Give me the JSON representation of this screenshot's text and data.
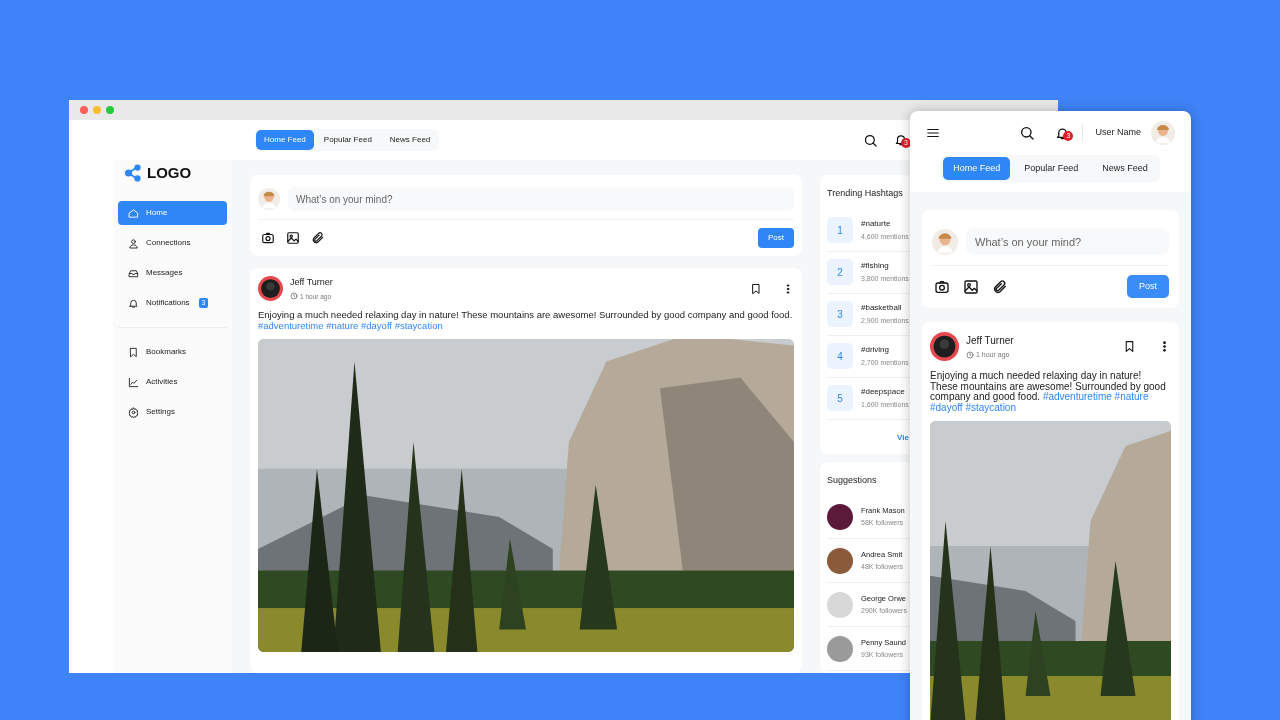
{
  "desktop": {
    "tabs": [
      {
        "label": "Home Feed",
        "selected": true
      },
      {
        "label": "Popular Feed",
        "selected": false
      },
      {
        "label": "News Feed",
        "selected": false
      }
    ],
    "notification_count": "3",
    "logo": "LOGO",
    "nav": [
      {
        "kind": "home",
        "label": "Home",
        "selected": true
      },
      {
        "kind": "user",
        "label": "Connections",
        "selected": false
      },
      {
        "kind": "inbox",
        "label": "Messages",
        "selected": false
      },
      {
        "kind": "bell",
        "label": "Notifications",
        "selected": false,
        "badge": "3"
      }
    ],
    "nav_secondary": [
      {
        "kind": "bookmark",
        "label": "Bookmarks",
        "selected": false
      },
      {
        "kind": "chart",
        "label": "Activities",
        "selected": false
      },
      {
        "kind": "gear",
        "label": "Settings",
        "selected": false
      }
    ],
    "composer": {
      "placeholder": "What’s on your mind?",
      "button": "Post"
    },
    "post": {
      "author": "Jeff Turner",
      "time": "1 hour ago",
      "text": "Enjoying a much needed relaxing day in nature! These mountains are awesome! Surrounded by good company and good food.",
      "hashtags": [
        "#adventuretime",
        "#nature",
        "#dayoff",
        "#staycation"
      ]
    },
    "trending": {
      "title": "Trending Hashtags",
      "items": [
        {
          "rank": "1",
          "tag": "#naturte",
          "mentions": "4,600 mentions"
        },
        {
          "rank": "2",
          "tag": "#fishing",
          "mentions": "3,800 mentions"
        },
        {
          "rank": "3",
          "tag": "#basketball",
          "mentions": "2,900 mentions"
        },
        {
          "rank": "4",
          "tag": "#driving",
          "mentions": "2,700 mentions"
        },
        {
          "rank": "5",
          "tag": "#deepspace",
          "mentions": "1,600 mentions"
        }
      ],
      "view_all": "Vie"
    },
    "suggestions": {
      "title": "Suggestions",
      "items": [
        {
          "name": "Frank Mason",
          "followers": "58K followers",
          "color": "#5b1a3a"
        },
        {
          "name": "Andrea Smit",
          "followers": "48K followers",
          "color": "#8a5a3a"
        },
        {
          "name": "George Orwe",
          "followers": "290K followers",
          "color": "#d8d8d8"
        },
        {
          "name": "Penny Saund",
          "followers": "93K followers",
          "color": "#9a9a9a"
        }
      ]
    }
  },
  "mobile": {
    "notification_count": "3",
    "user_name": "User Name",
    "tabs": [
      {
        "label": "Home Feed",
        "selected": true
      },
      {
        "label": "Popular Feed",
        "selected": false
      },
      {
        "label": "News Feed",
        "selected": false
      }
    ],
    "composer": {
      "placeholder": "What’s on your mind?",
      "button": "Post"
    },
    "post": {
      "author": "Jeff Turner",
      "time": "1 hour ago",
      "text": "Enjoying a much needed relaxing day in nature! These mountains are awesome! Surrounded by good company and good food.",
      "hashtags": [
        "#adventuretime",
        "#nature",
        "#dayoff",
        "#staycation"
      ]
    }
  }
}
